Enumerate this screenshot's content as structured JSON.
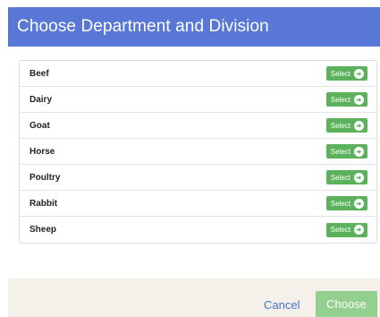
{
  "dialog": {
    "title": "Choose Department and Division"
  },
  "departments": [
    {
      "label": "Beef",
      "button": "Select"
    },
    {
      "label": "Dairy",
      "button": "Select"
    },
    {
      "label": "Goat",
      "button": "Select"
    },
    {
      "label": "Horse",
      "button": "Select"
    },
    {
      "label": "Poultry",
      "button": "Select"
    },
    {
      "label": "Rabbit",
      "button": "Select"
    },
    {
      "label": "Sheep",
      "button": "Select"
    }
  ],
  "footer": {
    "cancel_label": "Cancel",
    "choose_label": "Choose"
  },
  "colors": {
    "header_bg": "#5877d6",
    "select_button": "#5cb25c",
    "choose_button": "#93cf8e",
    "cancel_link": "#4a6fd0",
    "footer_bg": "#f5f1ea"
  },
  "icons": {
    "select": "arrow-circle-right-icon"
  }
}
